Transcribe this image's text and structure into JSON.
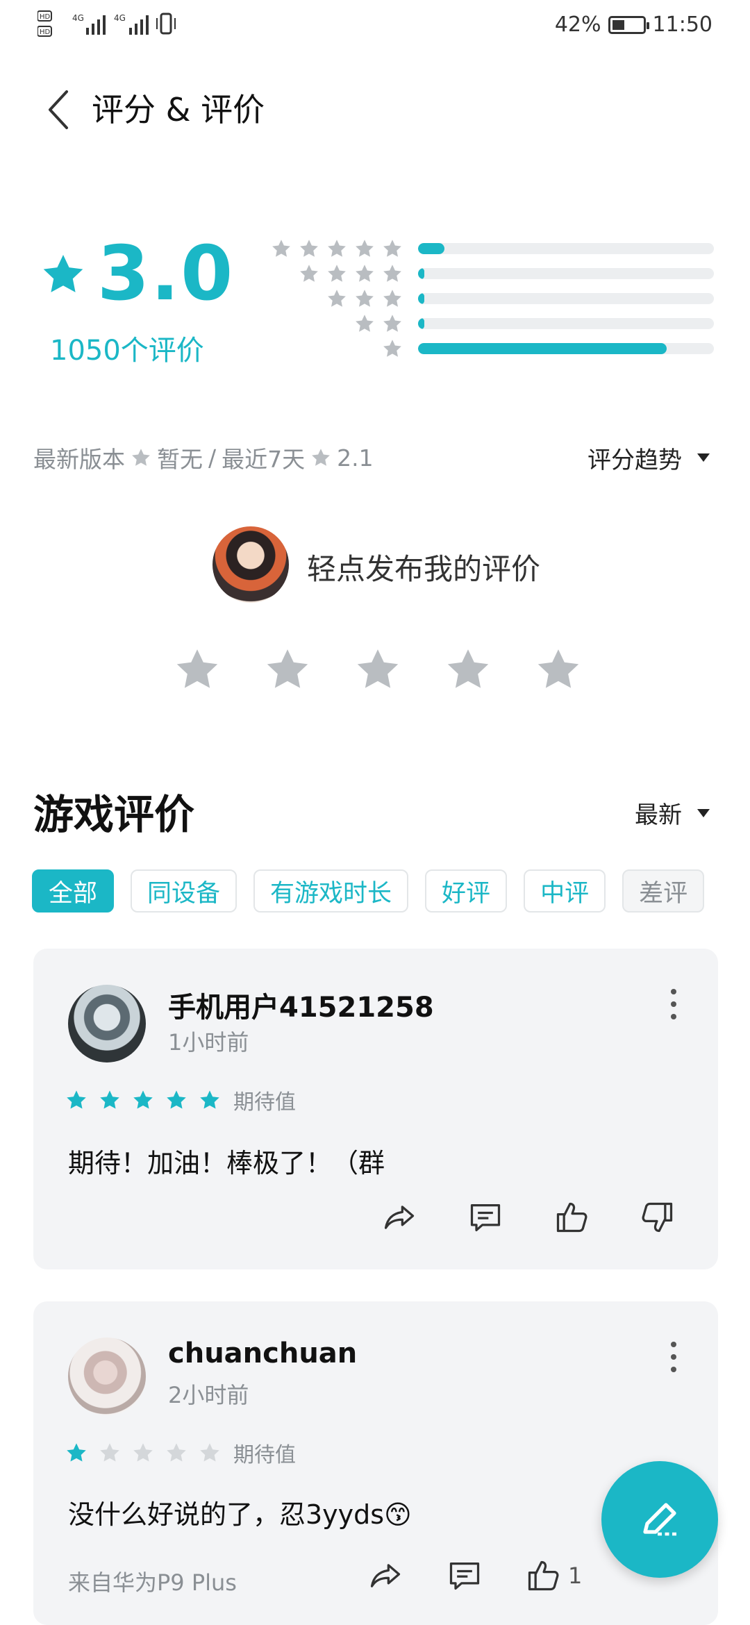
{
  "status_bar": {
    "signal_text": "HD 4G 4G",
    "battery": "42%",
    "battery_level": 0.42,
    "time": "11:50"
  },
  "header": {
    "title": "评分 & 评价"
  },
  "summary": {
    "score": "3.0",
    "count": "1050个评价",
    "distribution": [
      {
        "stars": 5,
        "fraction": 0.09
      },
      {
        "stars": 4,
        "fraction": 0.02
      },
      {
        "stars": 3,
        "fraction": 0.02
      },
      {
        "stars": 2,
        "fraction": 0.02
      },
      {
        "stars": 1,
        "fraction": 0.84
      }
    ],
    "accent_color": "#1bb7c6"
  },
  "version": {
    "latest_label": "最新版本",
    "latest_value": "暂无",
    "sep": "/",
    "recent_label": "最近7天",
    "recent_value": "2.1"
  },
  "trend": {
    "label": "评分趋势"
  },
  "my_review": {
    "prompt": "轻点发布我的评价",
    "rating": 0
  },
  "section": {
    "title": "游戏评价",
    "sort_label": "最新"
  },
  "filters": [
    "全部",
    "同设备",
    "有游戏时长",
    "好评",
    "中评",
    "差评"
  ],
  "reviews": [
    {
      "user": "手机用户41521258",
      "time": "1小时前",
      "rating": 5,
      "tag": "期待值",
      "text": "期待！加油！棒极了！（群",
      "device": "",
      "likes": ""
    },
    {
      "user": "chuanchuan",
      "time": "2小时前",
      "rating": 1,
      "tag": "期待值",
      "text": "没什么好说的了，忍3yyds😙",
      "device": "来自华为P9 Plus",
      "likes": "1"
    }
  ],
  "icons": {
    "back": "chevron-left-icon",
    "share": "share-icon",
    "comment": "comment-icon",
    "like": "thumbs-up-icon",
    "dislike": "thumbs-down-icon",
    "more": "more-vertical-icon",
    "compose": "pen-icon"
  }
}
